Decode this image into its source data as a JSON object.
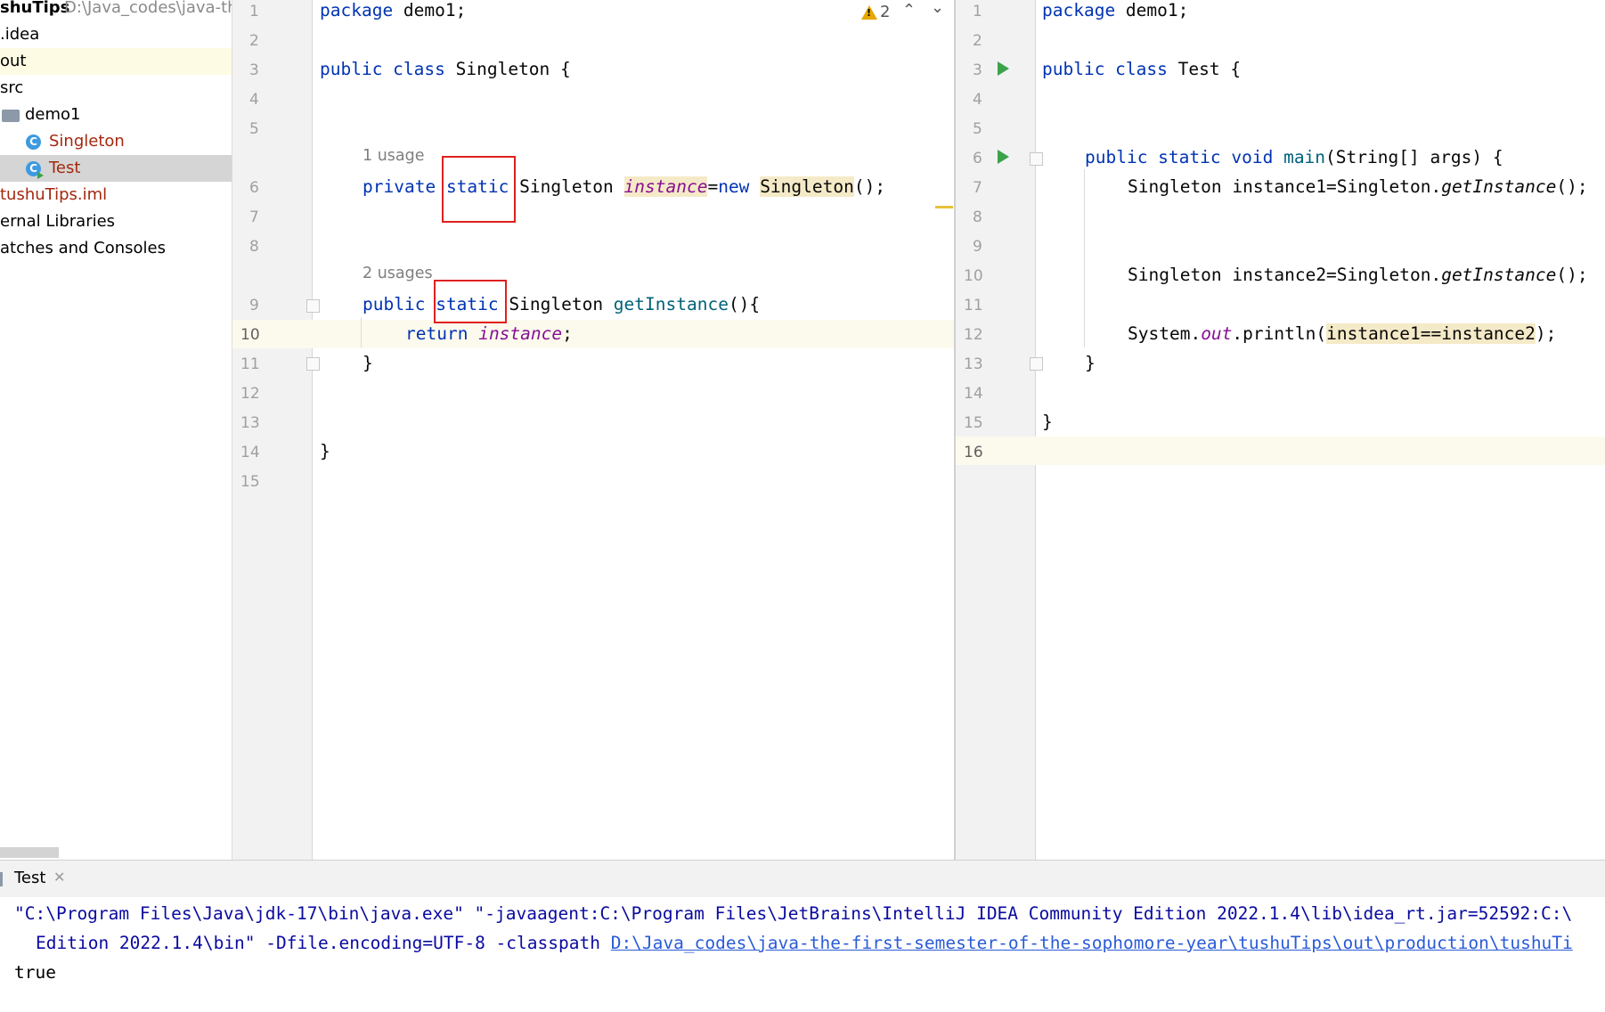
{
  "project": {
    "root_name": "shuTips",
    "root_path": "D:\\Java_codes\\java-th",
    "items": [
      {
        "label": ".idea"
      },
      {
        "label": "out"
      },
      {
        "label": "src"
      },
      {
        "label": "demo1"
      },
      {
        "label": "Singleton"
      },
      {
        "label": "Test"
      },
      {
        "label": "tushuTips.iml"
      },
      {
        "label": "ernal Libraries"
      },
      {
        "label": "atches and Consoles"
      }
    ]
  },
  "editor_left": {
    "warning_count": "2",
    "line_numbers": [
      "1",
      "2",
      "3",
      "4",
      "5",
      "6",
      "7",
      "8",
      "9",
      "10",
      "11",
      "12",
      "13",
      "14",
      "15"
    ],
    "usage_hints": [
      "1 usage",
      "2 usages"
    ],
    "code": {
      "l1_kw": "package",
      "l1_rest": " demo1;",
      "l3_kw": "public class",
      "l3_rest": " Singleton {",
      "l6_kw1": "private",
      "l6_kw2": "static",
      "l6_type": " Singleton ",
      "l6_field": "instance",
      "l6_eq": "=",
      "l6_new": "new",
      "l6_sp": " ",
      "l6_ctor": "Singleton",
      "l6_end": "();",
      "l9_kw1": "public",
      "l9_kw2": "static",
      "l9_type": " Singleton ",
      "l9_method": "getInstance",
      "l9_end": "(){",
      "l10_kw": "return",
      "l10_field": "instance",
      "l10_end": ";",
      "l11": "}",
      "l14": "}"
    }
  },
  "editor_right": {
    "line_numbers": [
      "1",
      "2",
      "3",
      "4",
      "5",
      "6",
      "7",
      "8",
      "9",
      "10",
      "11",
      "12",
      "13",
      "14",
      "15",
      "16"
    ],
    "code": {
      "l1_kw": "package",
      "l1_rest": " demo1;",
      "l3_kw": "public class",
      "l3_rest": " Test {",
      "l6_kw": "public static void",
      "l6_method": "main",
      "l6_rest": "(String[] args) {",
      "l7_pre": "Singleton instance1=Singleton.",
      "l7_call": "getInstance",
      "l7_end": "();",
      "l10_pre": "Singleton instance2=Singleton.",
      "l10_call": "getInstance",
      "l10_end": "();",
      "l12_pre": "System.",
      "l12_out": "out",
      "l12_mid": ".println(",
      "l12_hl": "instance1==instance2",
      "l12_end": ");",
      "l13": "}",
      "l15": "}"
    }
  },
  "run": {
    "tab_label": "Test",
    "line1": "\"C:\\Program Files\\Java\\jdk-17\\bin\\java.exe\" \"-javaagent:C:\\Program Files\\JetBrains\\IntelliJ IDEA Community Edition 2022.1.4\\lib\\idea_rt.jar=52592:C:\\",
    "line2_pre": "Edition 2022.1.4\\bin\" -Dfile.encoding=UTF-8 -classpath ",
    "line2_link": "D:\\Java_codes\\java-the-first-semester-of-the-sophomore-year\\tushuTips\\out\\production\\tushuTi",
    "line3": "true"
  },
  "colors": {
    "keyword": "#0033b3",
    "field": "#871094",
    "method": "#00627a",
    "highlight": "#f5eac8",
    "red_box": "#e02020"
  }
}
